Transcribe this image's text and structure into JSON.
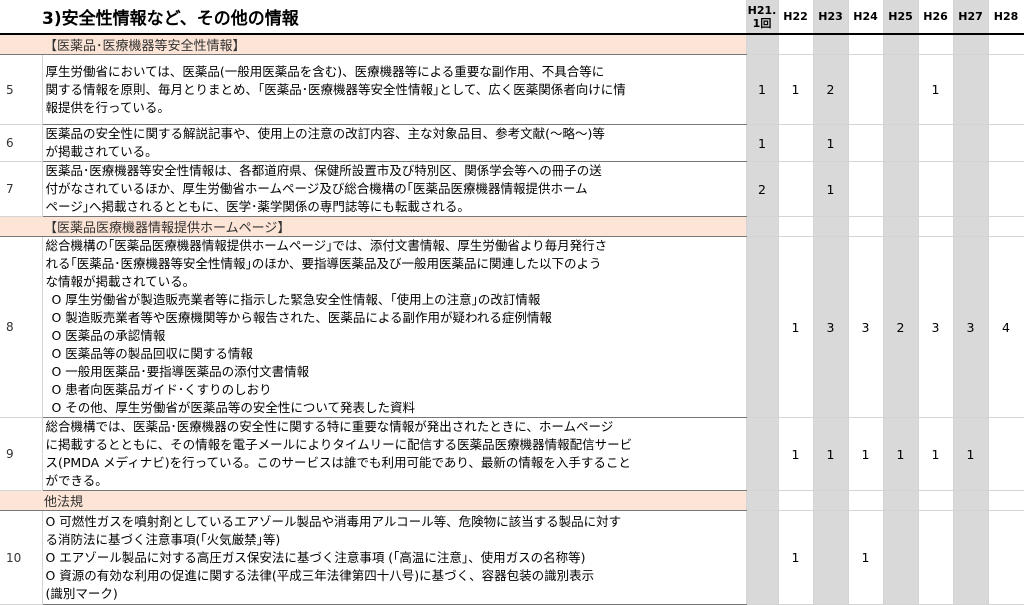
{
  "header": {
    "title": "3)安全性情報など、その他の情報",
    "year_line1": "H21.",
    "year_line2": "1回",
    "years": [
      "H22",
      "H23",
      "H24",
      "H25",
      "H26",
      "H27",
      "H28"
    ]
  },
  "rows": [
    {
      "kind": "section",
      "label": "【医薬品･医療機器等安全性情報】"
    },
    {
      "kind": "item",
      "num": "5",
      "lines": [
        "厚生労働省においては、医薬品(一般用医薬品を含む)、医療機器等による重要な副作用、不具合等に",
        "関する情報を原則、毎月とりまとめ、｢医薬品･医療機器等安全性情報｣として、広く医薬関係者向けに情",
        "報提供を行っている。"
      ],
      "values": [
        "1",
        "1",
        "2",
        "",
        "",
        "1",
        "",
        ""
      ]
    },
    {
      "kind": "item",
      "num": "6",
      "lines": [
        "医薬品の安全性に関する解説記事や、使用上の注意の改訂内容、主な対象品目、参考文献(～略～)等",
        "が掲載されている。"
      ],
      "values": [
        "1",
        "",
        "1",
        "",
        "",
        "",
        "",
        ""
      ]
    },
    {
      "kind": "item",
      "num": "7",
      "lines": [
        "医薬品･医療機器等安全性情報は、各都道府県、保健所設置市及び特別区、関係学会等への冊子の送",
        "付がなされているほか、厚生労働省ホームページ及び総合機構の｢医薬品医療機器情報提供ホーム",
        "ページ｣へ掲載されるとともに、医学･薬学関係の専門誌等にも転載される。"
      ],
      "values": [
        "2",
        "",
        "1",
        "",
        "",
        "",
        "",
        ""
      ]
    },
    {
      "kind": "section",
      "label": "【医薬品医療機器情報提供ホームページ】"
    },
    {
      "kind": "item",
      "num": "8",
      "lines": [
        "総合機構の｢医薬品医療機器情報提供ホームページ｣では、添付文書情報、厚生労働省より毎月発行さ",
        "れる｢医薬品･医療機器等安全性情報｣のほか、要指導医薬品及び一般用医薬品に関連した以下のよう",
        "な情報が掲載されている。"
      ],
      "bullets": [
        "O 厚生労働省が製造販売業者等に指示した緊急安全性情報、｢使用上の注意｣の改訂情報",
        "O 製造販売業者等や医療機関等から報告された、医薬品による副作用が疑われる症例情報",
        "O 医薬品の承認情報",
        "O 医薬品等の製品回収に関する情報",
        "O 一般用医薬品･要指導医薬品の添付文書情報",
        "O 患者向医薬品ガイド･くすりのしおり",
        "O その他、厚生労働省が医薬品等の安全性について発表した資料"
      ],
      "values": [
        "",
        "1",
        "3",
        "3",
        "2",
        "3",
        "3",
        "4"
      ]
    },
    {
      "kind": "item",
      "num": "9",
      "lines": [
        "総合機構では、医薬品･医療機器の安全性に関する特に重要な情報が発出されたときに、ホームページ",
        "に掲載するとともに、その情報を電子メールによりタイムリーに配信する医薬品医療機器情報配信サービ",
        "ス(PMDA メディナビ)を行っている。このサービスは誰でも利用可能であり、最新の情報を入手すること",
        "ができる。"
      ],
      "values": [
        "",
        "1",
        "1",
        "1",
        "1",
        "1",
        "1",
        ""
      ]
    },
    {
      "kind": "section",
      "label": "他法規"
    },
    {
      "kind": "item",
      "num": "10",
      "lines": [
        "O 可燃性ガスを噴射剤としているエアゾール製品や消毒用アルコール等、危険物に該当する製品に対す",
        "る消防法に基づく注意事項(｢火気厳禁｣等)",
        "O エアゾール製品に対する高圧ガス保安法に基づく注意事項 (｢高温に注意｣、使用ガスの名称等)",
        "O 資源の有効な利用の促進に関する法律(平成三年法律第四十八号)に基づく、容器包装の識別表示",
        "(識別マーク)"
      ],
      "values": [
        "",
        "1",
        "",
        "1",
        "",
        "",
        "",
        ""
      ]
    }
  ]
}
